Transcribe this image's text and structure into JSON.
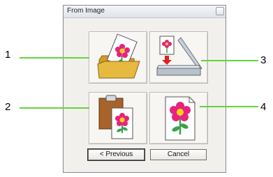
{
  "window": {
    "title": "From Image"
  },
  "buttons": {
    "previous_label": "< Previous",
    "cancel_label": "Cancel"
  },
  "callouts": [
    "1",
    "2",
    "3",
    "4"
  ],
  "colors": {
    "leader_line": "#63d43a",
    "flower": "#e8237c",
    "folder": "#e7b93f"
  }
}
